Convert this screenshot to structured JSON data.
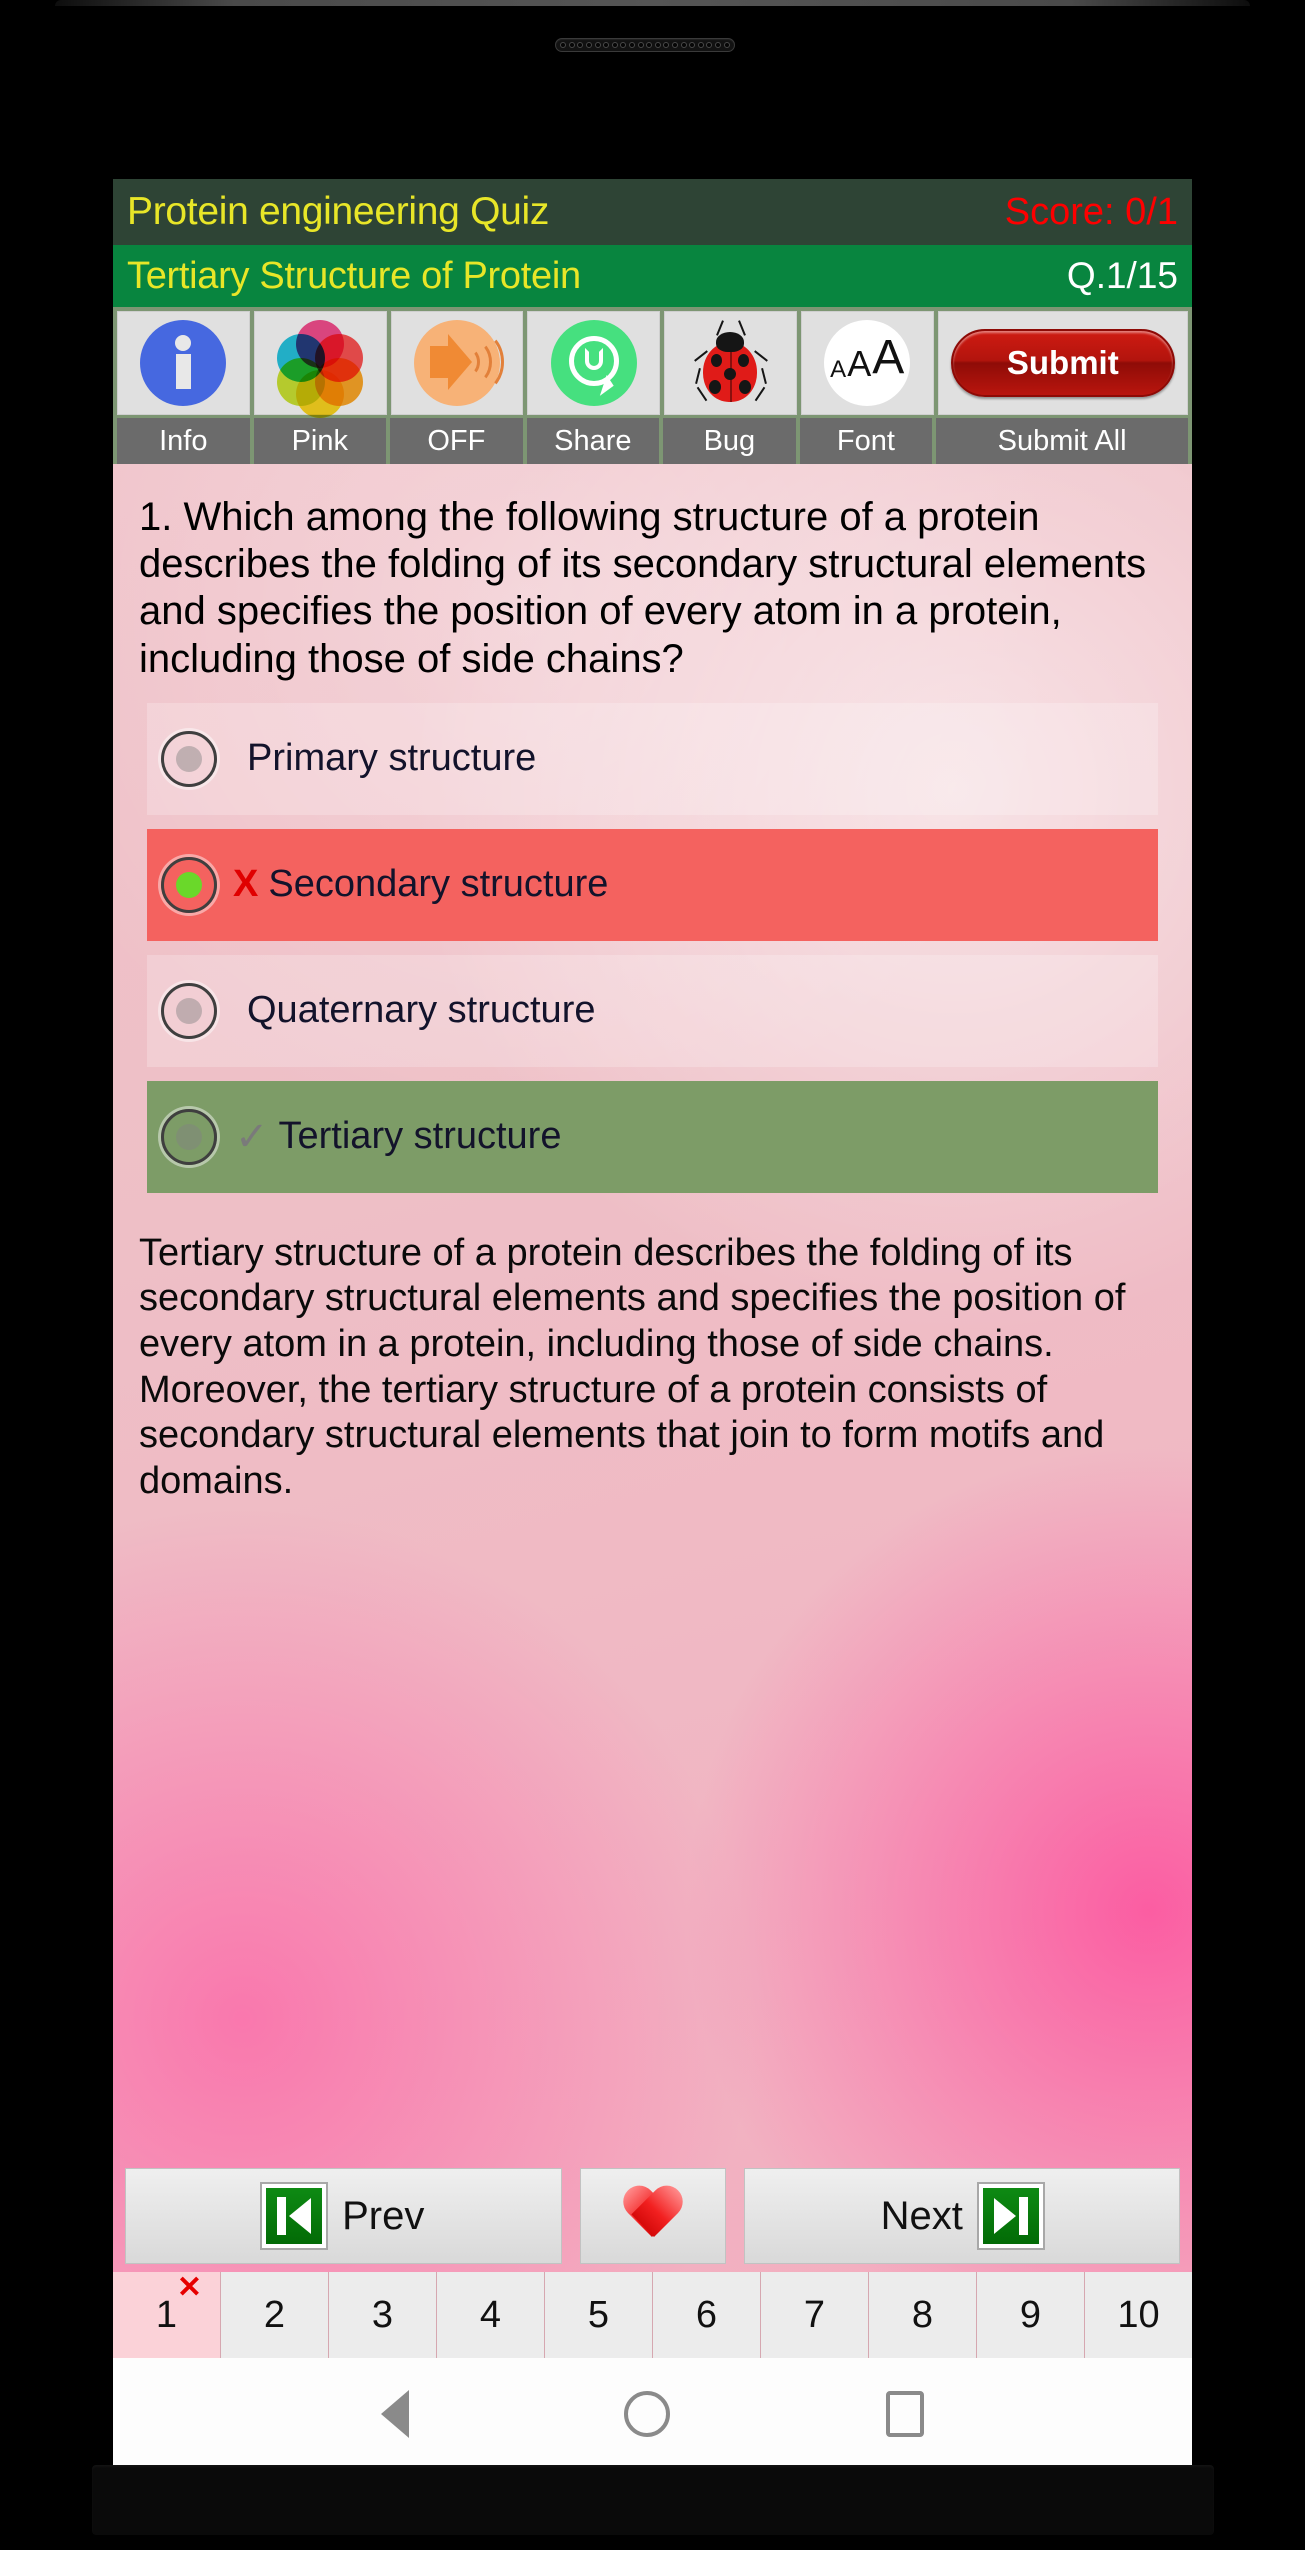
{
  "app": {
    "title": "Protein engineering Quiz",
    "score": "Score: 0/1",
    "subject": "Tertiary Structure of Protein",
    "question_counter": "Q.1/15"
  },
  "toolbar": {
    "items": [
      {
        "icon": "info-icon",
        "label": "Info"
      },
      {
        "icon": "color-wheel-icon",
        "label": "Pink"
      },
      {
        "icon": "speaker-icon",
        "label": "OFF"
      },
      {
        "icon": "whatsapp-icon",
        "label": "Share"
      },
      {
        "icon": "ladybug-icon",
        "label": "Bug"
      },
      {
        "icon": "font-size-icon",
        "label": "Font"
      }
    ],
    "submit_button_label": "Submit",
    "submit_label": "Submit All"
  },
  "question": {
    "text": "1. Which among the following structure of a protein describes the folding of its secondary structural elements and specifies the position of every atom in a protein, including those of side chains?",
    "options": [
      {
        "label": "Primary structure",
        "state": "neutral",
        "selected": false,
        "mark": ""
      },
      {
        "label": "Secondary structure",
        "state": "wrong",
        "selected": true,
        "mark": "X"
      },
      {
        "label": "Quaternary structure",
        "state": "neutral",
        "selected": false,
        "mark": ""
      },
      {
        "label": "Tertiary structure",
        "state": "correct",
        "selected": false,
        "mark": "✓"
      }
    ],
    "explanation": "Tertiary structure of a protein describes the folding of its secondary structural elements and specifies the position of every atom in a protein, including those of side chains. Moreover, the tertiary structure of a protein consists of secondary structural elements that join to form motifs and domains."
  },
  "navigation": {
    "prev_label": "Prev",
    "next_label": "Next",
    "favorite_icon": "heart-icon",
    "prev_icon": "skip-to-start-icon",
    "next_icon": "skip-to-end-icon"
  },
  "pager": {
    "pages": [
      "1",
      "2",
      "3",
      "4",
      "5",
      "6",
      "7",
      "8",
      "9",
      "10"
    ],
    "current": "1",
    "current_mark": "✕"
  },
  "android_nav": {
    "back": "back-icon",
    "home": "home-icon",
    "recents": "recents-icon"
  },
  "colors": {
    "titlebar_bg": "#2e4435",
    "subjectbar_bg": "#08853f",
    "title_text": "#e8e628",
    "score_text": "#fe0000",
    "toolbar_bg": "#7d9673",
    "wrong_bg": "#f4625f",
    "correct_bg": "#7d9c67",
    "submit_red": "#b2140d"
  }
}
